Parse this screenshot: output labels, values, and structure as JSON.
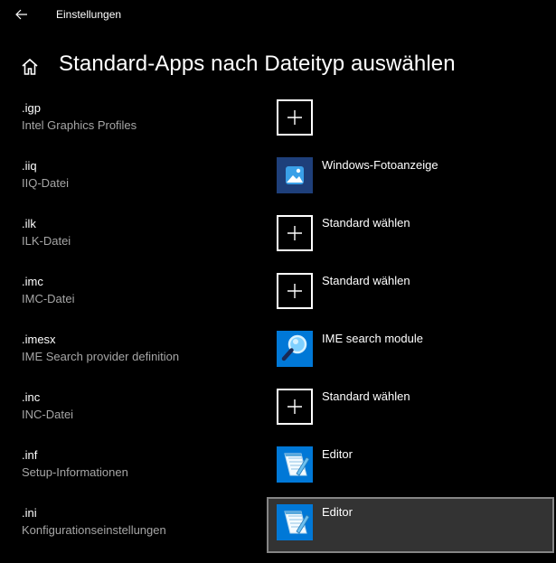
{
  "window": {
    "title": "Einstellungen"
  },
  "header": {
    "title": "Standard-Apps nach Dateityp auswählen"
  },
  "rows": [
    {
      "ext": ".igp",
      "desc": "Intel Graphics Profiles",
      "app": "",
      "icon": "plus-icon"
    },
    {
      "ext": ".iiq",
      "desc": "IIQ-Datei",
      "app": "Windows-Fotoanzeige",
      "icon": "photo-viewer-icon"
    },
    {
      "ext": ".ilk",
      "desc": "ILK-Datei",
      "app": "Standard wählen",
      "icon": "plus-icon"
    },
    {
      "ext": ".imc",
      "desc": "IMC-Datei",
      "app": "Standard wählen",
      "icon": "plus-icon"
    },
    {
      "ext": ".imesx",
      "desc": "IME Search provider definition",
      "app": "IME search module",
      "icon": "magnifier-icon"
    },
    {
      "ext": ".inc",
      "desc": "INC-Datei",
      "app": "Standard wählen",
      "icon": "plus-icon"
    },
    {
      "ext": ".inf",
      "desc": "Setup-Informationen",
      "app": "Editor",
      "icon": "notepad-icon"
    },
    {
      "ext": ".ini",
      "desc": "Konfigurationseinstellungen",
      "app": "Editor",
      "icon": "notepad-icon"
    }
  ],
  "colors": {
    "background": "#000000",
    "secondary_text": "#a6a6a6",
    "hover_background": "#333333",
    "hover_border": "#858585",
    "accent_tile": "#0078d7"
  }
}
